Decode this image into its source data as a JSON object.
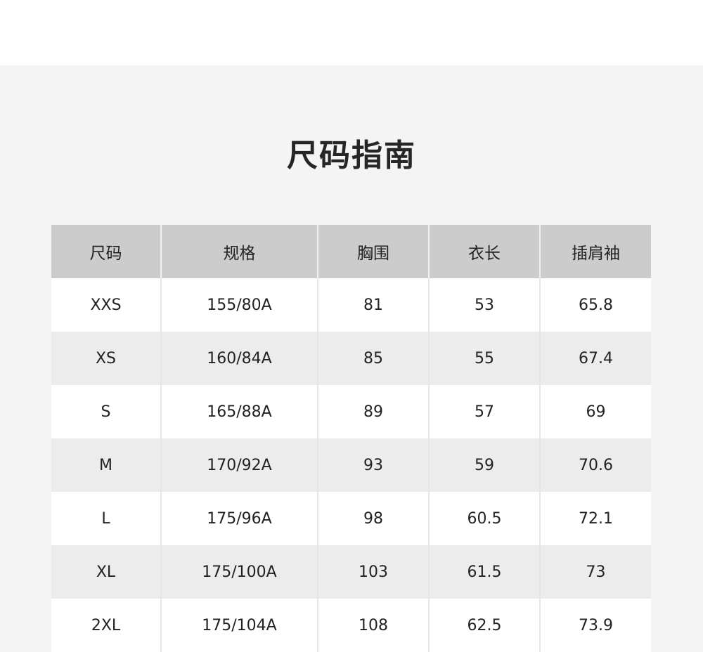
{
  "title": "尺码指南",
  "table": {
    "headers": [
      "尺码",
      "规格",
      "胸围",
      "衣长",
      "插肩袖"
    ],
    "rows": [
      [
        "XXS",
        "155/80A",
        "81",
        "53",
        "65.8"
      ],
      [
        "XS",
        "160/84A",
        "85",
        "55",
        "67.4"
      ],
      [
        "S",
        "165/88A",
        "89",
        "57",
        "69"
      ],
      [
        "M",
        "170/92A",
        "93",
        "59",
        "70.6"
      ],
      [
        "L",
        "175/96A",
        "98",
        "60.5",
        "72.1"
      ],
      [
        "XL",
        "175/100A",
        "103",
        "61.5",
        "73"
      ],
      [
        "2XL",
        "175/104A",
        "108",
        "62.5",
        "73.9"
      ]
    ]
  }
}
